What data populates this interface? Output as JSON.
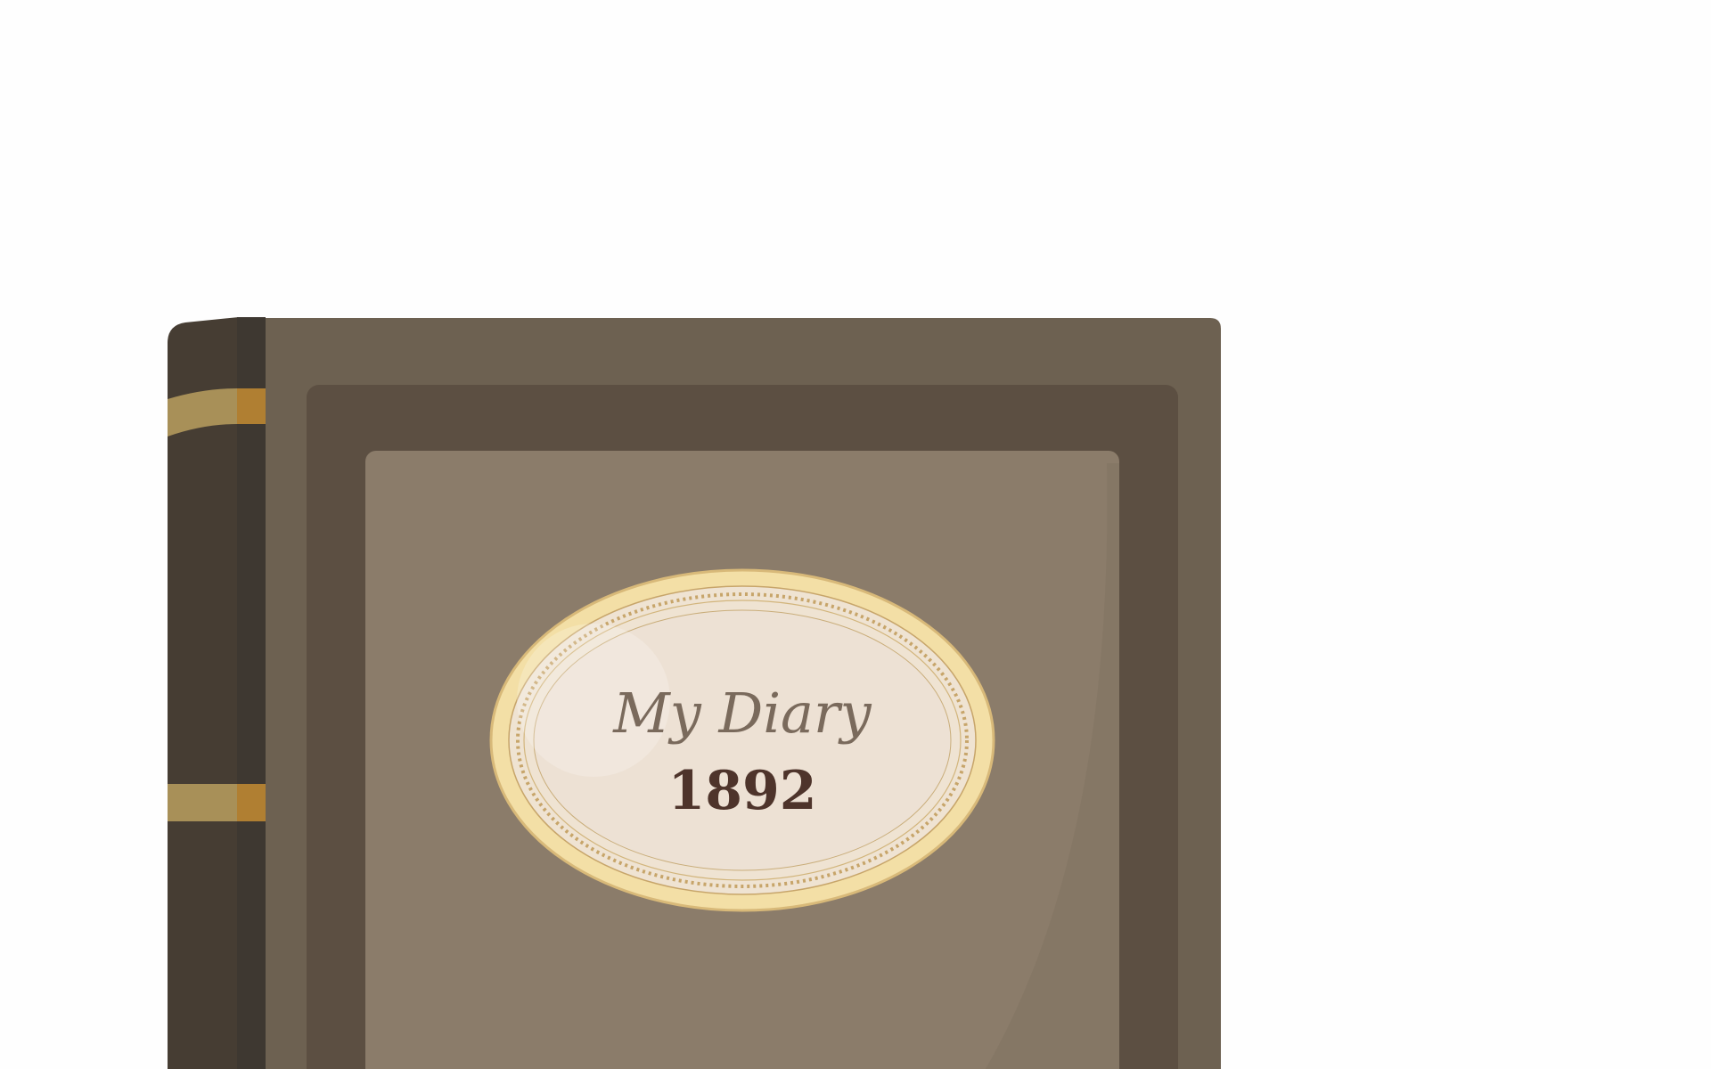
{
  "book": {
    "title": "My Diary",
    "year": "1892"
  },
  "colors": {
    "background": "#fefefe",
    "cover_outer": "#6d6151",
    "cover_frame": "#5c4f42",
    "cover_panel": "#8b7c6a",
    "spine_dark": "#463d33",
    "spine_edge": "#3e3831",
    "spine_band": "#a89058",
    "spine_band_edge": "#b07f32",
    "label_rim": "#f3dfa6",
    "label_rim_stroke": "#d8b979",
    "label_face": "#ede1d4",
    "label_ornament": "#c7a56a",
    "title_text": "#7a6a5c",
    "year_text": "#4e342b"
  }
}
